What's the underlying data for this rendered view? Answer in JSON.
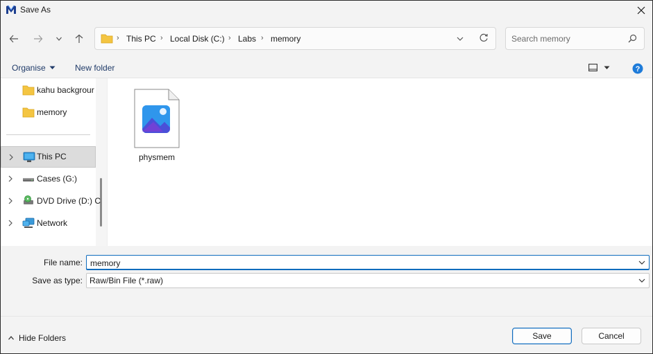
{
  "window": {
    "title": "Save As"
  },
  "address": {
    "crumbs": [
      "This PC",
      "Local Disk (C:)",
      "Labs",
      "memory"
    ]
  },
  "search": {
    "placeholder": "Search memory"
  },
  "toolbar": {
    "organise_label": "Organise",
    "new_folder_label": "New folder"
  },
  "nav": {
    "items": [
      {
        "label": "kahu backgrour"
      },
      {
        "label": "memory"
      },
      {
        "label": "This PC"
      },
      {
        "label": "Cases (G:)"
      },
      {
        "label": "DVD Drive (D:) C"
      },
      {
        "label": "Network"
      }
    ]
  },
  "files": [
    {
      "name": "physmem"
    }
  ],
  "form": {
    "file_name_label": "File name:",
    "file_name_value": "memory",
    "type_label": "Save as type:",
    "type_value": "Raw/Bin File (*.raw)"
  },
  "footer": {
    "hide_folders_label": "Hide Folders",
    "save_label": "Save",
    "cancel_label": "Cancel"
  },
  "colors": {
    "accent": "#0f6cbd",
    "folder": "#f4c542",
    "link_text": "#1f3a68"
  }
}
